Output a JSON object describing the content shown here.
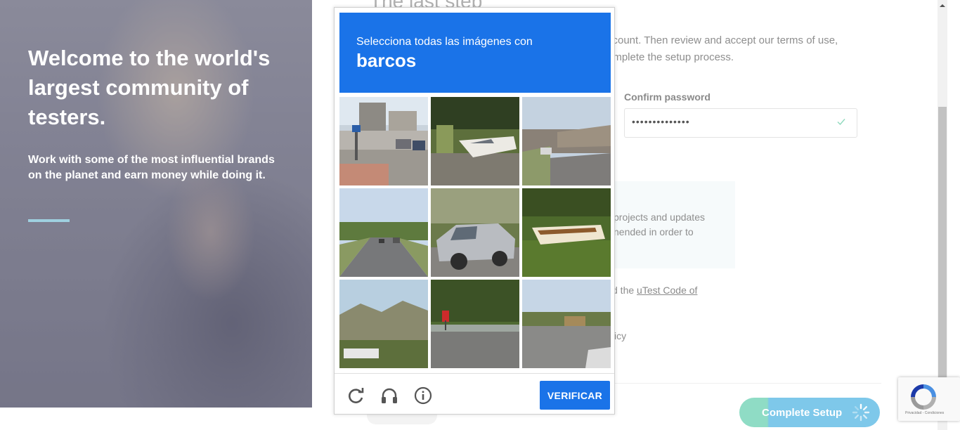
{
  "hero": {
    "title": "Welcome to the world's largest community of testers.",
    "subtitle": "Work with some of the most influential brands on the planet and earn money while doing it."
  },
  "form": {
    "step_title": "The last step",
    "intro_text": "ccount. Then review and accept our terms of use, omplete the setup process.",
    "confirm_password_label": "Confirm password",
    "confirm_password_value": "••••••••••••••",
    "optin_text": "projects and updates nended in order to",
    "code_prefix": "d the",
    "code_link": "uTest Code of",
    "policy_fragment": "icy",
    "complete_button": "Complete Setup"
  },
  "captcha": {
    "instruction": "Selecciona todas las imágenes con",
    "target": "barcos",
    "verify_button": "VERIFICAR",
    "tiles": [
      "parking lot street corner",
      "boat in driveway",
      "highway overpass",
      "highway road",
      "silver car on street",
      "boat on trailer in grass",
      "mountains and trees",
      "residential street with stop sign",
      "intersection road"
    ]
  },
  "recaptcha_badge": {
    "terms": "Privacidad - Condiciones"
  },
  "colors": {
    "captcha_blue": "#1a73e8",
    "button_gradient_green": "#8fdcc5",
    "button_gradient_blue": "#7ec8ea",
    "hero_rule": "#9fd0e0"
  }
}
